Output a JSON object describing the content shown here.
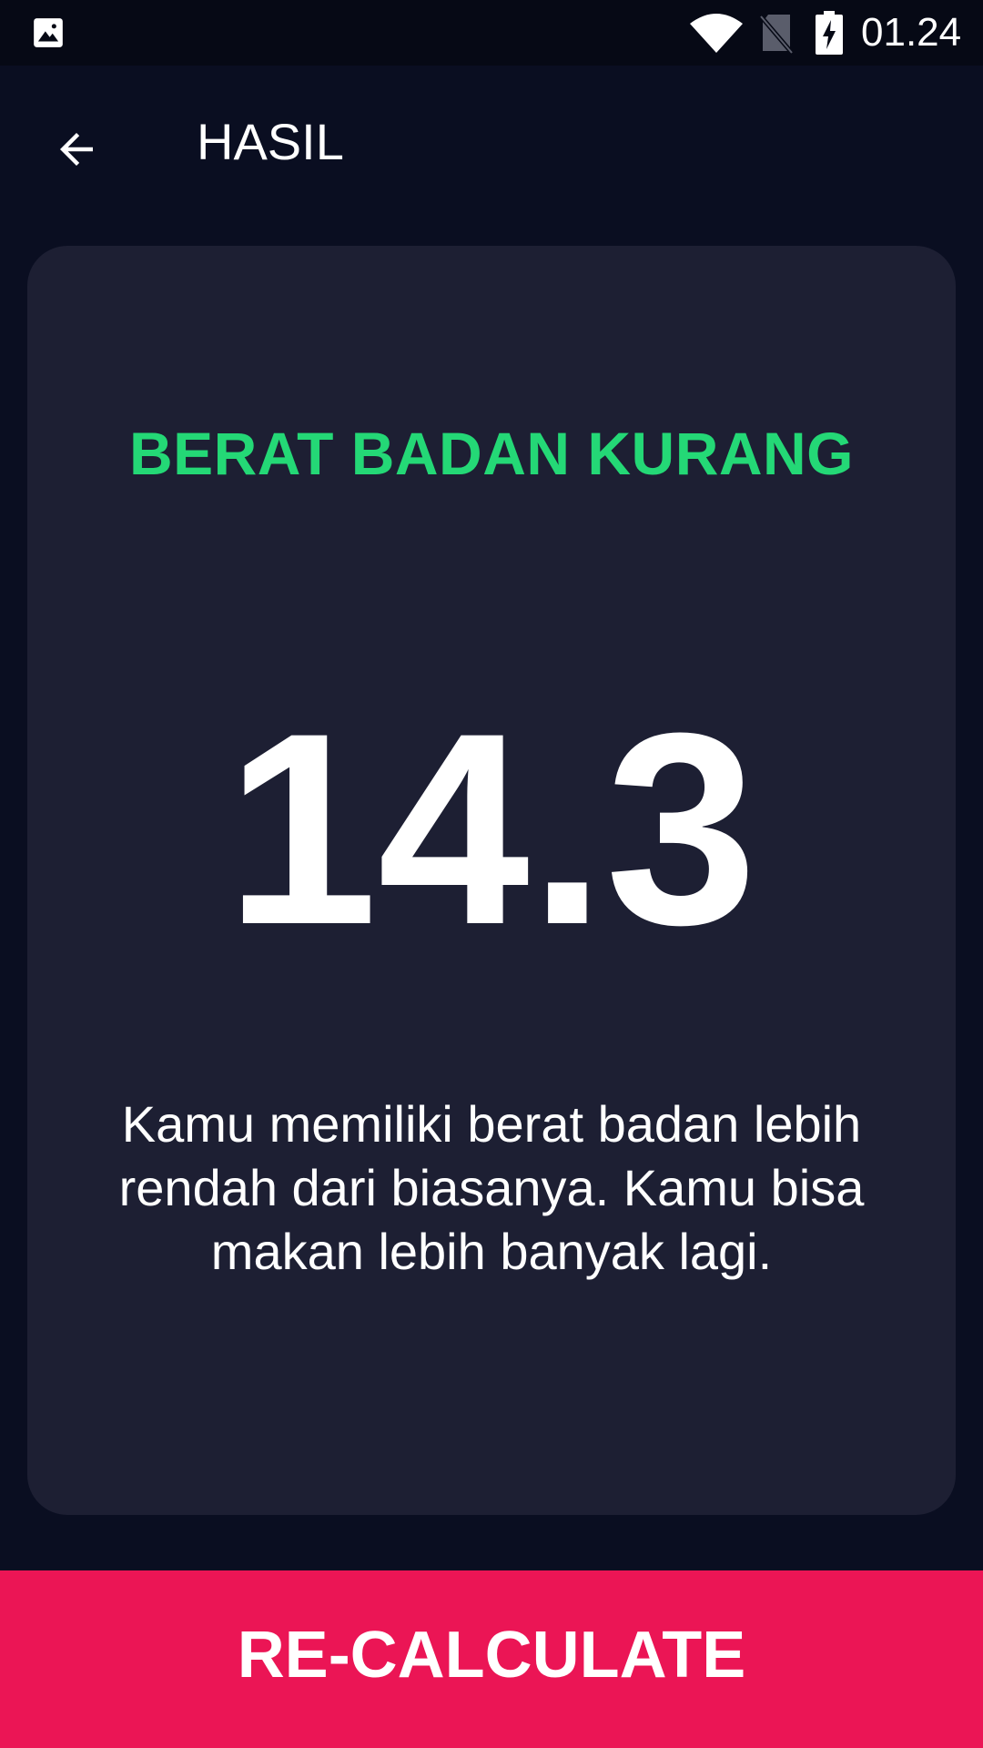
{
  "status_bar": {
    "time": "01.24",
    "icons": [
      "gallery-icon",
      "wifi-icon",
      "no-sim-icon",
      "battery-charging-icon"
    ]
  },
  "app_bar": {
    "back_icon": "arrow-back-icon",
    "title": "HASIL"
  },
  "result": {
    "status": "BERAT BADAN KURANG",
    "value": "14.3",
    "description": "Kamu memiliki berat badan lebih rendah dari biasanya. Kamu bisa makan lebih banyak lagi."
  },
  "footer": {
    "recalculate_label": "RE-CALCULATE"
  },
  "colors": {
    "background": "#0a0e21",
    "card": "#1d1f33",
    "status_green": "#24d876",
    "button_pink": "#eb1555",
    "text": "#ffffff"
  }
}
